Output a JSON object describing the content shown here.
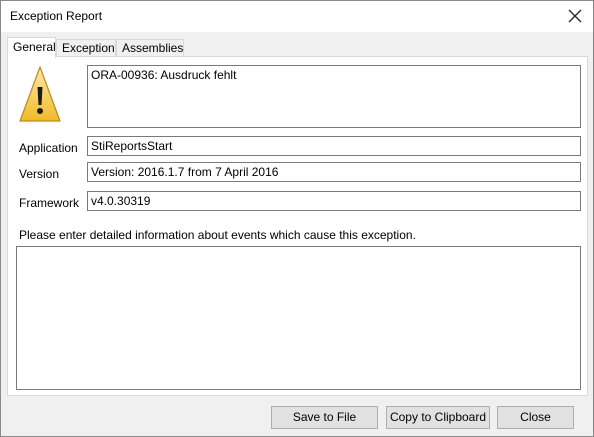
{
  "window": {
    "title": "Exception Report"
  },
  "tabs": [
    "General",
    "Exception",
    "Assemblies"
  ],
  "general": {
    "message": "ORA-00936: Ausdruck fehlt",
    "application_label": "Application",
    "application_value": "StiReportsStart",
    "version_label": "Version",
    "version_value": "Version: 2016.1.7 from 7 April 2016",
    "framework_label": "Framework",
    "framework_value": "v4.0.30319",
    "details_prompt": "Please enter detailed information about events which cause this exception.",
    "details_value": ""
  },
  "buttons": {
    "save": "Save to File",
    "copy": "Copy to Clipboard",
    "close": "Close"
  },
  "icons": {
    "warning": "warning-triangle-icon",
    "close": "close-icon"
  }
}
